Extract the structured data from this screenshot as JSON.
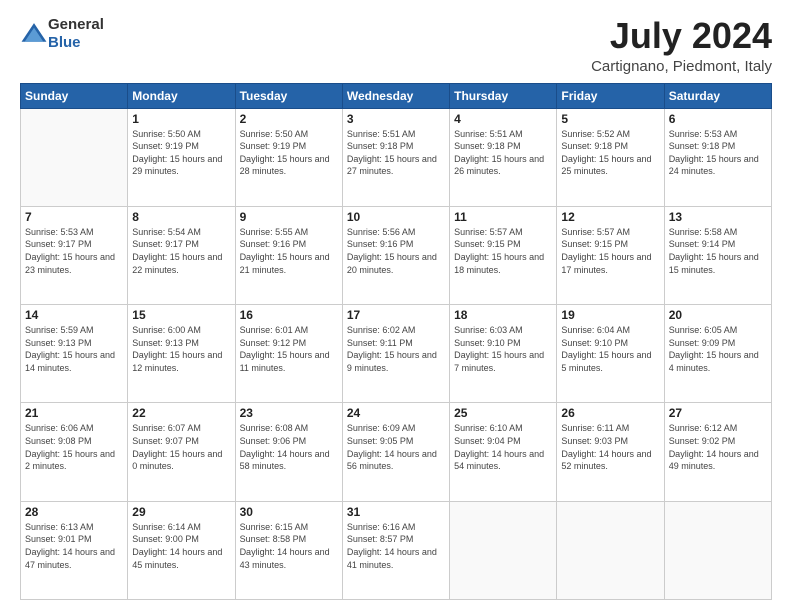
{
  "logo": {
    "general": "General",
    "blue": "Blue"
  },
  "title": {
    "month": "July 2024",
    "location": "Cartignano, Piedmont, Italy"
  },
  "weekdays": [
    "Sunday",
    "Monday",
    "Tuesday",
    "Wednesday",
    "Thursday",
    "Friday",
    "Saturday"
  ],
  "weeks": [
    [
      {
        "day": "",
        "sunrise": "",
        "sunset": "",
        "daylight": ""
      },
      {
        "day": "1",
        "sunrise": "Sunrise: 5:50 AM",
        "sunset": "Sunset: 9:19 PM",
        "daylight": "Daylight: 15 hours and 29 minutes."
      },
      {
        "day": "2",
        "sunrise": "Sunrise: 5:50 AM",
        "sunset": "Sunset: 9:19 PM",
        "daylight": "Daylight: 15 hours and 28 minutes."
      },
      {
        "day": "3",
        "sunrise": "Sunrise: 5:51 AM",
        "sunset": "Sunset: 9:18 PM",
        "daylight": "Daylight: 15 hours and 27 minutes."
      },
      {
        "day": "4",
        "sunrise": "Sunrise: 5:51 AM",
        "sunset": "Sunset: 9:18 PM",
        "daylight": "Daylight: 15 hours and 26 minutes."
      },
      {
        "day": "5",
        "sunrise": "Sunrise: 5:52 AM",
        "sunset": "Sunset: 9:18 PM",
        "daylight": "Daylight: 15 hours and 25 minutes."
      },
      {
        "day": "6",
        "sunrise": "Sunrise: 5:53 AM",
        "sunset": "Sunset: 9:18 PM",
        "daylight": "Daylight: 15 hours and 24 minutes."
      }
    ],
    [
      {
        "day": "7",
        "sunrise": "Sunrise: 5:53 AM",
        "sunset": "Sunset: 9:17 PM",
        "daylight": "Daylight: 15 hours and 23 minutes."
      },
      {
        "day": "8",
        "sunrise": "Sunrise: 5:54 AM",
        "sunset": "Sunset: 9:17 PM",
        "daylight": "Daylight: 15 hours and 22 minutes."
      },
      {
        "day": "9",
        "sunrise": "Sunrise: 5:55 AM",
        "sunset": "Sunset: 9:16 PM",
        "daylight": "Daylight: 15 hours and 21 minutes."
      },
      {
        "day": "10",
        "sunrise": "Sunrise: 5:56 AM",
        "sunset": "Sunset: 9:16 PM",
        "daylight": "Daylight: 15 hours and 20 minutes."
      },
      {
        "day": "11",
        "sunrise": "Sunrise: 5:57 AM",
        "sunset": "Sunset: 9:15 PM",
        "daylight": "Daylight: 15 hours and 18 minutes."
      },
      {
        "day": "12",
        "sunrise": "Sunrise: 5:57 AM",
        "sunset": "Sunset: 9:15 PM",
        "daylight": "Daylight: 15 hours and 17 minutes."
      },
      {
        "day": "13",
        "sunrise": "Sunrise: 5:58 AM",
        "sunset": "Sunset: 9:14 PM",
        "daylight": "Daylight: 15 hours and 15 minutes."
      }
    ],
    [
      {
        "day": "14",
        "sunrise": "Sunrise: 5:59 AM",
        "sunset": "Sunset: 9:13 PM",
        "daylight": "Daylight: 15 hours and 14 minutes."
      },
      {
        "day": "15",
        "sunrise": "Sunrise: 6:00 AM",
        "sunset": "Sunset: 9:13 PM",
        "daylight": "Daylight: 15 hours and 12 minutes."
      },
      {
        "day": "16",
        "sunrise": "Sunrise: 6:01 AM",
        "sunset": "Sunset: 9:12 PM",
        "daylight": "Daylight: 15 hours and 11 minutes."
      },
      {
        "day": "17",
        "sunrise": "Sunrise: 6:02 AM",
        "sunset": "Sunset: 9:11 PM",
        "daylight": "Daylight: 15 hours and 9 minutes."
      },
      {
        "day": "18",
        "sunrise": "Sunrise: 6:03 AM",
        "sunset": "Sunset: 9:10 PM",
        "daylight": "Daylight: 15 hours and 7 minutes."
      },
      {
        "day": "19",
        "sunrise": "Sunrise: 6:04 AM",
        "sunset": "Sunset: 9:10 PM",
        "daylight": "Daylight: 15 hours and 5 minutes."
      },
      {
        "day": "20",
        "sunrise": "Sunrise: 6:05 AM",
        "sunset": "Sunset: 9:09 PM",
        "daylight": "Daylight: 15 hours and 4 minutes."
      }
    ],
    [
      {
        "day": "21",
        "sunrise": "Sunrise: 6:06 AM",
        "sunset": "Sunset: 9:08 PM",
        "daylight": "Daylight: 15 hours and 2 minutes."
      },
      {
        "day": "22",
        "sunrise": "Sunrise: 6:07 AM",
        "sunset": "Sunset: 9:07 PM",
        "daylight": "Daylight: 15 hours and 0 minutes."
      },
      {
        "day": "23",
        "sunrise": "Sunrise: 6:08 AM",
        "sunset": "Sunset: 9:06 PM",
        "daylight": "Daylight: 14 hours and 58 minutes."
      },
      {
        "day": "24",
        "sunrise": "Sunrise: 6:09 AM",
        "sunset": "Sunset: 9:05 PM",
        "daylight": "Daylight: 14 hours and 56 minutes."
      },
      {
        "day": "25",
        "sunrise": "Sunrise: 6:10 AM",
        "sunset": "Sunset: 9:04 PM",
        "daylight": "Daylight: 14 hours and 54 minutes."
      },
      {
        "day": "26",
        "sunrise": "Sunrise: 6:11 AM",
        "sunset": "Sunset: 9:03 PM",
        "daylight": "Daylight: 14 hours and 52 minutes."
      },
      {
        "day": "27",
        "sunrise": "Sunrise: 6:12 AM",
        "sunset": "Sunset: 9:02 PM",
        "daylight": "Daylight: 14 hours and 49 minutes."
      }
    ],
    [
      {
        "day": "28",
        "sunrise": "Sunrise: 6:13 AM",
        "sunset": "Sunset: 9:01 PM",
        "daylight": "Daylight: 14 hours and 47 minutes."
      },
      {
        "day": "29",
        "sunrise": "Sunrise: 6:14 AM",
        "sunset": "Sunset: 9:00 PM",
        "daylight": "Daylight: 14 hours and 45 minutes."
      },
      {
        "day": "30",
        "sunrise": "Sunrise: 6:15 AM",
        "sunset": "Sunset: 8:58 PM",
        "daylight": "Daylight: 14 hours and 43 minutes."
      },
      {
        "day": "31",
        "sunrise": "Sunrise: 6:16 AM",
        "sunset": "Sunset: 8:57 PM",
        "daylight": "Daylight: 14 hours and 41 minutes."
      },
      {
        "day": "",
        "sunrise": "",
        "sunset": "",
        "daylight": ""
      },
      {
        "day": "",
        "sunrise": "",
        "sunset": "",
        "daylight": ""
      },
      {
        "day": "",
        "sunrise": "",
        "sunset": "",
        "daylight": ""
      }
    ]
  ]
}
